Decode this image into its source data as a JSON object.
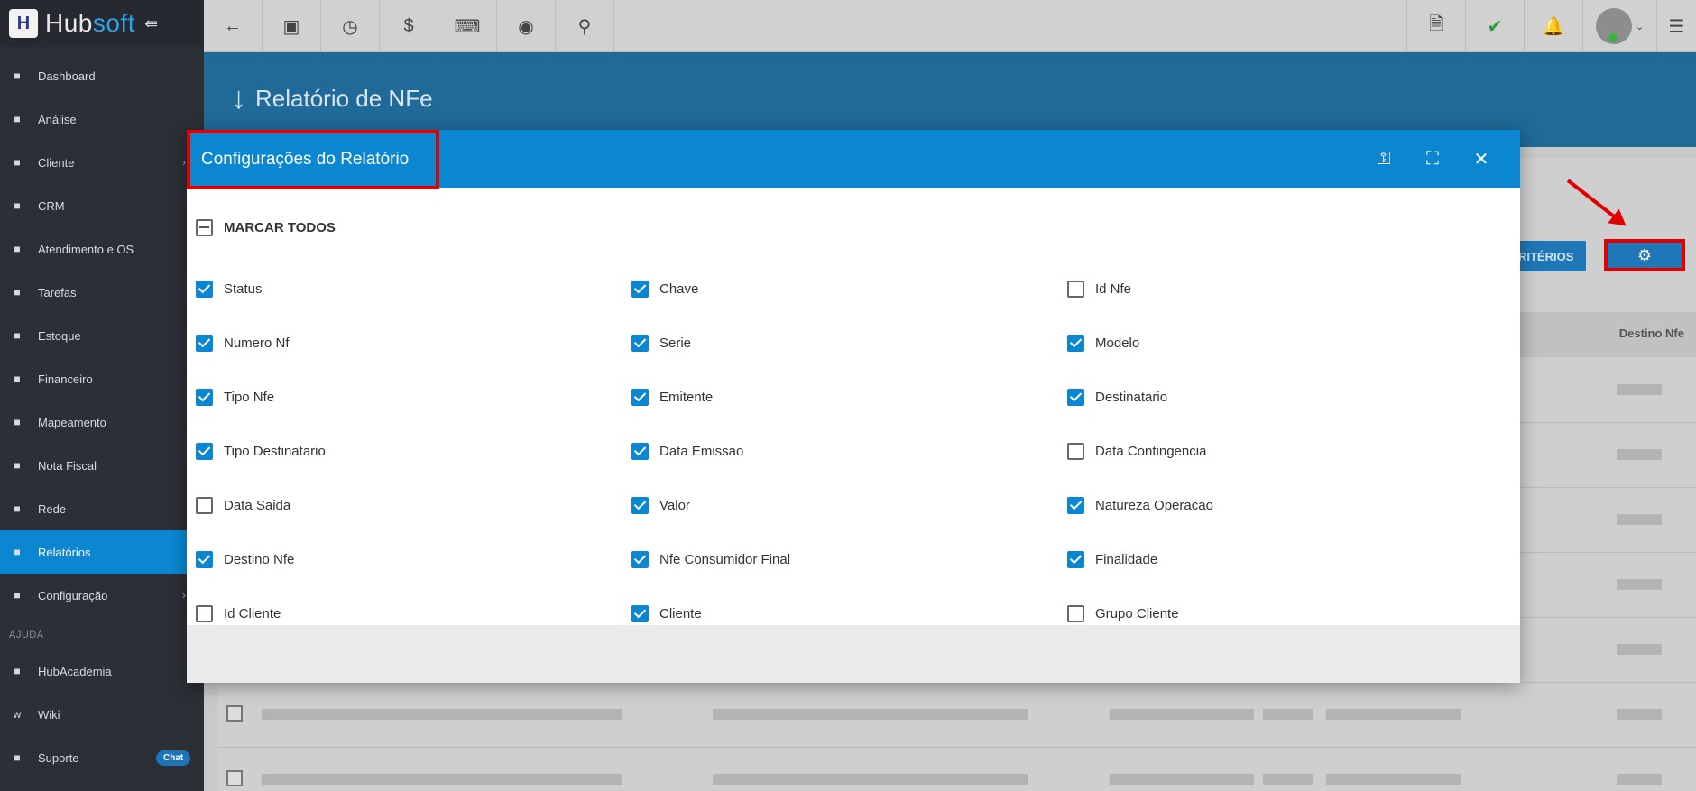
{
  "app": {
    "logo_text_a": "Hub",
    "logo_text_b": "soft"
  },
  "sidebar": {
    "items": [
      {
        "label": "Dashboard",
        "icon": "dashboard-icon"
      },
      {
        "label": "Análise",
        "icon": "pie-chart-icon"
      },
      {
        "label": "Cliente",
        "icon": "contact-card-icon"
      },
      {
        "label": "CRM",
        "icon": "board-icon"
      },
      {
        "label": "Atendimento e OS",
        "icon": "calendar-clock-icon"
      },
      {
        "label": "Tarefas",
        "icon": "calendar-icon"
      },
      {
        "label": "Estoque",
        "icon": "box-icon"
      },
      {
        "label": "Financeiro",
        "icon": "money-icon"
      },
      {
        "label": "Mapeamento",
        "icon": "map-pin-icon"
      },
      {
        "label": "Nota Fiscal",
        "icon": "receipt-icon"
      },
      {
        "label": "Rede",
        "icon": "network-icon"
      },
      {
        "label": "Relatórios",
        "icon": "document-icon"
      },
      {
        "label": "Configuração",
        "icon": "gear-icon"
      }
    ],
    "help_section": "AJUDA",
    "help_items": [
      {
        "label": "HubAcademia",
        "icon": "youtube-icon"
      },
      {
        "label": "Wiki",
        "icon": "wiki-icon"
      },
      {
        "label": "Suporte",
        "icon": "support-icon"
      }
    ],
    "chat_badge": "Chat"
  },
  "page": {
    "title": "Relatório de NFe",
    "criterios_button": "CRITÉRIOS",
    "destino_header": "Destino Nfe"
  },
  "modal": {
    "title": "Configurações do Relatório",
    "mark_all": "MARCAR TODOS",
    "options": [
      {
        "label": "Status",
        "checked": true
      },
      {
        "label": "Chave",
        "checked": true
      },
      {
        "label": "Id Nfe",
        "checked": false
      },
      {
        "label": "Numero Nf",
        "checked": true
      },
      {
        "label": "Serie",
        "checked": true
      },
      {
        "label": "Modelo",
        "checked": true
      },
      {
        "label": "Tipo Nfe",
        "checked": true
      },
      {
        "label": "Emitente",
        "checked": true
      },
      {
        "label": "Destinatario",
        "checked": true
      },
      {
        "label": "Tipo Destinatario",
        "checked": true
      },
      {
        "label": "Data Emissao",
        "checked": true
      },
      {
        "label": "Data Contingencia",
        "checked": false
      },
      {
        "label": "Data Saida",
        "checked": false
      },
      {
        "label": "Valor",
        "checked": true
      },
      {
        "label": "Natureza Operacao",
        "checked": true
      },
      {
        "label": "Destino Nfe",
        "checked": true
      },
      {
        "label": "Nfe Consumidor Final",
        "checked": true
      },
      {
        "label": "Finalidade",
        "checked": true
      },
      {
        "label": "Id Cliente",
        "checked": false
      },
      {
        "label": "Cliente",
        "checked": true
      },
      {
        "label": "Grupo Cliente",
        "checked": false
      }
    ]
  }
}
